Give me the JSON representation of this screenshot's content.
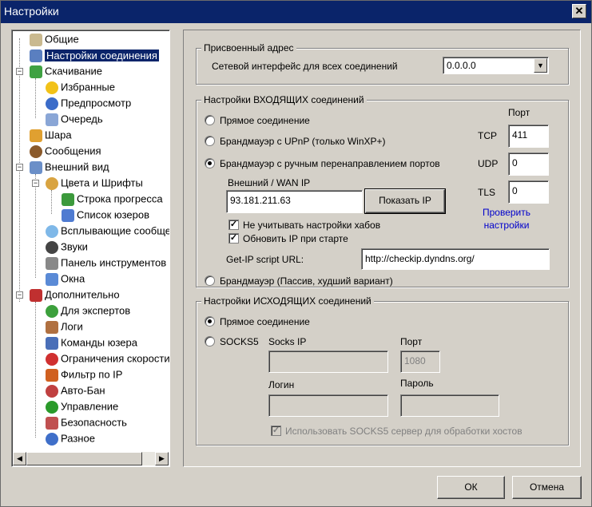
{
  "window": {
    "title": "Настройки",
    "close": "✕"
  },
  "tree": {
    "items": [
      {
        "label": "Общие"
      },
      {
        "label": "Настройки соединения"
      },
      {
        "label": "Скачивание"
      },
      {
        "label": "Избранные"
      },
      {
        "label": "Предпросмотр"
      },
      {
        "label": "Очередь"
      },
      {
        "label": "Шара"
      },
      {
        "label": "Сообщения"
      },
      {
        "label": "Внешний вид"
      },
      {
        "label": "Цвета и Шрифты"
      },
      {
        "label": "Строка прогресса"
      },
      {
        "label": "Список юзеров"
      },
      {
        "label": "Всплывающие сообщения"
      },
      {
        "label": "Звуки"
      },
      {
        "label": "Панель инструментов"
      },
      {
        "label": "Окна"
      },
      {
        "label": "Дополнительно"
      },
      {
        "label": "Для экспертов"
      },
      {
        "label": "Логи"
      },
      {
        "label": "Команды юзера"
      },
      {
        "label": "Ограничения скорости"
      },
      {
        "label": "Фильтр по IP"
      },
      {
        "label": "Авто-Бан"
      },
      {
        "label": "Управление"
      },
      {
        "label": "Безопасность"
      },
      {
        "label": "Разное"
      }
    ]
  },
  "assigned": {
    "title": "Присвоенный адрес",
    "label": "Сетевой интерфейс для всех соединений",
    "value": "0.0.0.0"
  },
  "incoming": {
    "title": "Настройки ВХОДЯЩИХ соединений",
    "direct": "Прямое соединение",
    "upnp": "Брандмауэр с UPnP (только WinXP+)",
    "manual": "Брандмауэр с ручным перенаправлением портов",
    "passive": "Брандмауэр (Пассив, худший вариант)",
    "wan_label": "Внешний / WAN IP",
    "wan_value": "93.181.211.63",
    "show_ip": "Показать IP",
    "ignore_hub": "Не учитывать настройки хабов",
    "update_ip": "Обновить IP при старте",
    "getip_label": "Get-IP script URL:",
    "getip_value": "http://checkip.dyndns.org/",
    "port_header": "Порт",
    "tcp_label": "TCP",
    "tcp_value": "411",
    "udp_label": "UDP",
    "udp_value": "0",
    "tls_label": "TLS",
    "tls_value": "0",
    "check_link_1": "Проверить",
    "check_link_2": "настройки"
  },
  "outgoing": {
    "title": "Настройки ИСХОДЯЩИХ соединений",
    "direct": "Прямое соединение",
    "socks5": "SOCKS5",
    "socks_ip_label": "Socks IP",
    "socks_ip_value": "",
    "port_label": "Порт",
    "port_value": "1080",
    "login_label": "Логин",
    "login_value": "",
    "password_label": "Пароль",
    "password_value": "",
    "use_socks_hosts": "Использовать SOCKS5 сервер для обработки хостов"
  },
  "buttons": {
    "ok": "ОК",
    "cancel": "Отмена"
  }
}
